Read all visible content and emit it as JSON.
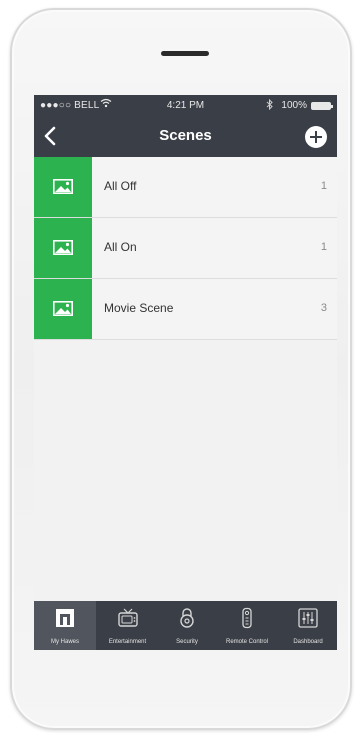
{
  "status_bar": {
    "carrier": "●●●○○ BELL",
    "time": "4:21 PM",
    "battery": "100%"
  },
  "nav": {
    "title": "Scenes",
    "back_icon": "chevron-left-icon",
    "add_icon": "plus-circle-icon"
  },
  "scenes": [
    {
      "name": "All Off",
      "count": "1",
      "icon": "image-icon"
    },
    {
      "name": "All On",
      "count": "1",
      "icon": "image-icon"
    },
    {
      "name": "Movie Scene",
      "count": "3",
      "icon": "image-icon"
    }
  ],
  "tabs": [
    {
      "label": "My Hawes",
      "icon": "home-icon",
      "active": true
    },
    {
      "label": "Entertainment",
      "icon": "tv-icon",
      "active": false
    },
    {
      "label": "Security",
      "icon": "lock-icon",
      "active": false
    },
    {
      "label": "Remote Control",
      "icon": "remote-icon",
      "active": false
    },
    {
      "label": "Dashboard",
      "icon": "sliders-icon",
      "active": false
    }
  ],
  "colors": {
    "bar": "#3a3e46",
    "accent_green": "#2cb24f",
    "active_tab": "#51565e"
  }
}
